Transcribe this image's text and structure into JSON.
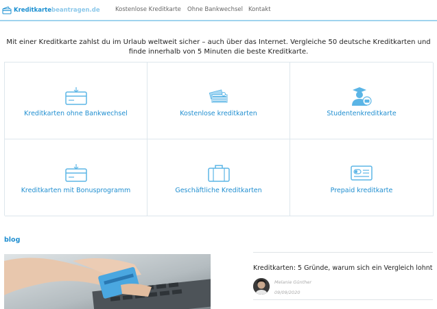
{
  "header": {
    "logo_part1": "Kreditkarte",
    "logo_part2": "beantragen.de",
    "nav": [
      "Kostenlose Kreditkarte",
      "Ohne Bankwechsel",
      "Kontakt"
    ]
  },
  "intro": "Mit einer Kreditkarte zahlst du im Urlaub weltweit sicher – auch über das Internet. Vergleiche 50 deutsche Kreditkarten und finde innerhalb von 5 Minuten die beste Kreditkarte.",
  "categories": [
    {
      "label": "Kreditkarten ohne Bankwechsel",
      "icon": "card-terminal-icon"
    },
    {
      "label": "Kostenlose kreditkarten",
      "icon": "money-stack-icon"
    },
    {
      "label": "Studentenkreditkarte",
      "icon": "graduate-card-icon"
    },
    {
      "label": "Kreditkarten mit Bonusprogramm",
      "icon": "card-terminal-icon"
    },
    {
      "label": "Geschäftliche Kreditkarten",
      "icon": "briefcase-icon"
    },
    {
      "label": "Prepaid kreditkarte",
      "icon": "prepaid-card-icon"
    }
  ],
  "blog": {
    "label": "blog",
    "article": {
      "title": "Kreditkarten: 5 Gründe, warum sich ein Vergleich lohnt",
      "author": "Melanie Günther",
      "date": "09/09/2020"
    }
  },
  "colors": {
    "accent": "#1f8ed0",
    "icon": "#5bb5e6",
    "border": "#dde6ec"
  }
}
